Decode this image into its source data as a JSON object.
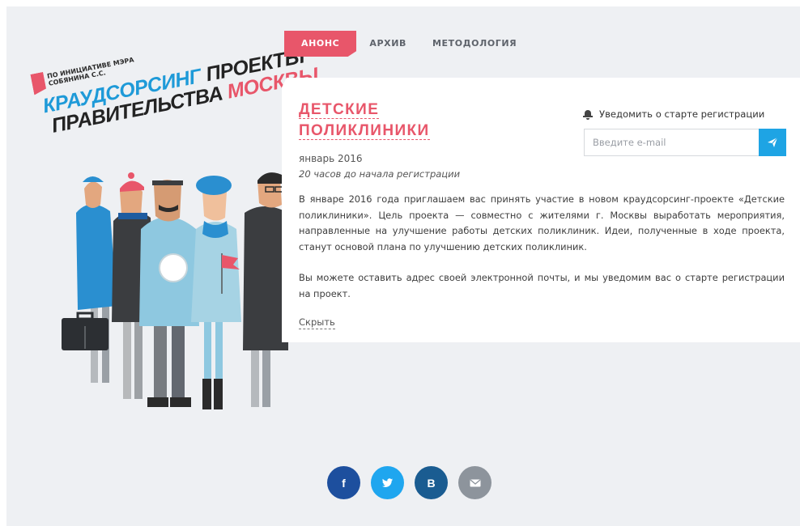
{
  "logo": {
    "initiative": "По инициативе мэра Собянина С.С.",
    "line1_blue": "Краудсорсинг",
    "line1_dark": "проекты",
    "line2_dark": "правительства",
    "line2_red": "Москвы"
  },
  "nav": {
    "items": [
      {
        "label": "АНОНС",
        "active": true
      },
      {
        "label": "АРХИВ",
        "active": false
      },
      {
        "label": "МЕТОДОЛОГИЯ",
        "active": false
      }
    ]
  },
  "project": {
    "title_line1": "ДЕТСКИЕ",
    "title_line2": "ПОЛИКЛИНИКИ",
    "date": "январь 2016",
    "countdown": "20 часов до начала регистрации",
    "paragraph1": "В январе 2016 года приглашаем вас принять участие в новом краудсорсинг-проекте «Детские поликлиники». Цель проекта — совместно с жителями г. Москвы выработать мероприятия, направленные на улучшение работы детских поликлиник. Идеи, полученные в ходе проекта, станут основой плана по улучшению детских поликлиник.",
    "paragraph2": "Вы можете оставить адрес своей электронной почты, и мы уведомим вас о старте регистрации на проект.",
    "hide_label": "Скрыть"
  },
  "notify": {
    "label": "Уведомить о старте регистрации",
    "email_placeholder": "Введите e-mail",
    "icon": "bell-icon",
    "send_icon": "paper-plane-icon"
  },
  "social": {
    "items": [
      {
        "name": "facebook",
        "glyph": "f",
        "color": "#1d4f9e"
      },
      {
        "name": "twitter",
        "glyph": "",
        "color": "#1fa6ef"
      },
      {
        "name": "vkontakte",
        "glyph": "B",
        "color": "#1a5c91"
      },
      {
        "name": "email",
        "glyph": "",
        "color": "#8d949c"
      }
    ]
  },
  "colors": {
    "accent": "#e8566a",
    "blue": "#1e9ad8",
    "send_button": "#1ea4e4"
  }
}
